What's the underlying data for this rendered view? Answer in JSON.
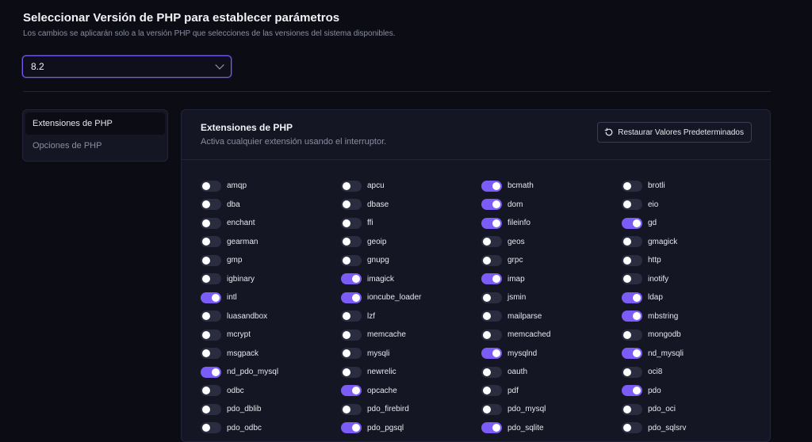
{
  "header": {
    "title": "Seleccionar Versión de PHP para establecer parámetros",
    "subtitle": "Los cambios se aplicarán solo a la versión PHP que selecciones de las versiones del sistema disponibles."
  },
  "version_select": {
    "value": "8.2"
  },
  "sidebar": {
    "items": [
      {
        "label": "Extensiones de PHP",
        "active": true
      },
      {
        "label": "Opciones de PHP",
        "active": false
      }
    ]
  },
  "panel": {
    "title": "Extensiones de PHP",
    "subtitle": "Activa cualquier extensión usando el interruptor.",
    "restore_label": "Restaurar Valores Predeterminados"
  },
  "colors": {
    "accent": "#7c5cf6",
    "toggle_off": "#2a2c3f",
    "background": "#0b0c14",
    "panel": "#151623"
  },
  "extensions": [
    {
      "name": "amqp",
      "enabled": false
    },
    {
      "name": "apcu",
      "enabled": false
    },
    {
      "name": "bcmath",
      "enabled": true
    },
    {
      "name": "brotli",
      "enabled": false
    },
    {
      "name": "dba",
      "enabled": false
    },
    {
      "name": "dbase",
      "enabled": false
    },
    {
      "name": "dom",
      "enabled": true
    },
    {
      "name": "eio",
      "enabled": false
    },
    {
      "name": "enchant",
      "enabled": false
    },
    {
      "name": "ffi",
      "enabled": false
    },
    {
      "name": "fileinfo",
      "enabled": true
    },
    {
      "name": "gd",
      "enabled": true
    },
    {
      "name": "gearman",
      "enabled": false
    },
    {
      "name": "geoip",
      "enabled": false
    },
    {
      "name": "geos",
      "enabled": false
    },
    {
      "name": "gmagick",
      "enabled": false
    },
    {
      "name": "gmp",
      "enabled": false
    },
    {
      "name": "gnupg",
      "enabled": false
    },
    {
      "name": "grpc",
      "enabled": false
    },
    {
      "name": "http",
      "enabled": false
    },
    {
      "name": "igbinary",
      "enabled": false
    },
    {
      "name": "imagick",
      "enabled": true
    },
    {
      "name": "imap",
      "enabled": true
    },
    {
      "name": "inotify",
      "enabled": false
    },
    {
      "name": "intl",
      "enabled": true
    },
    {
      "name": "ioncube_loader",
      "enabled": true
    },
    {
      "name": "jsmin",
      "enabled": false
    },
    {
      "name": "ldap",
      "enabled": true
    },
    {
      "name": "luasandbox",
      "enabled": false
    },
    {
      "name": "lzf",
      "enabled": false
    },
    {
      "name": "mailparse",
      "enabled": false
    },
    {
      "name": "mbstring",
      "enabled": true
    },
    {
      "name": "mcrypt",
      "enabled": false
    },
    {
      "name": "memcache",
      "enabled": false
    },
    {
      "name": "memcached",
      "enabled": false
    },
    {
      "name": "mongodb",
      "enabled": false
    },
    {
      "name": "msgpack",
      "enabled": false
    },
    {
      "name": "mysqli",
      "enabled": false
    },
    {
      "name": "mysqlnd",
      "enabled": true
    },
    {
      "name": "nd_mysqli",
      "enabled": true
    },
    {
      "name": "nd_pdo_mysql",
      "enabled": true
    },
    {
      "name": "newrelic",
      "enabled": false
    },
    {
      "name": "oauth",
      "enabled": false
    },
    {
      "name": "oci8",
      "enabled": false
    },
    {
      "name": "odbc",
      "enabled": false
    },
    {
      "name": "opcache",
      "enabled": true
    },
    {
      "name": "pdf",
      "enabled": false
    },
    {
      "name": "pdo",
      "enabled": true
    },
    {
      "name": "pdo_dblib",
      "enabled": false
    },
    {
      "name": "pdo_firebird",
      "enabled": false
    },
    {
      "name": "pdo_mysql",
      "enabled": false
    },
    {
      "name": "pdo_oci",
      "enabled": false
    },
    {
      "name": "pdo_odbc",
      "enabled": false
    },
    {
      "name": "pdo_pgsql",
      "enabled": true
    },
    {
      "name": "pdo_sqlite",
      "enabled": true
    },
    {
      "name": "pdo_sqlsrv",
      "enabled": false
    }
  ]
}
